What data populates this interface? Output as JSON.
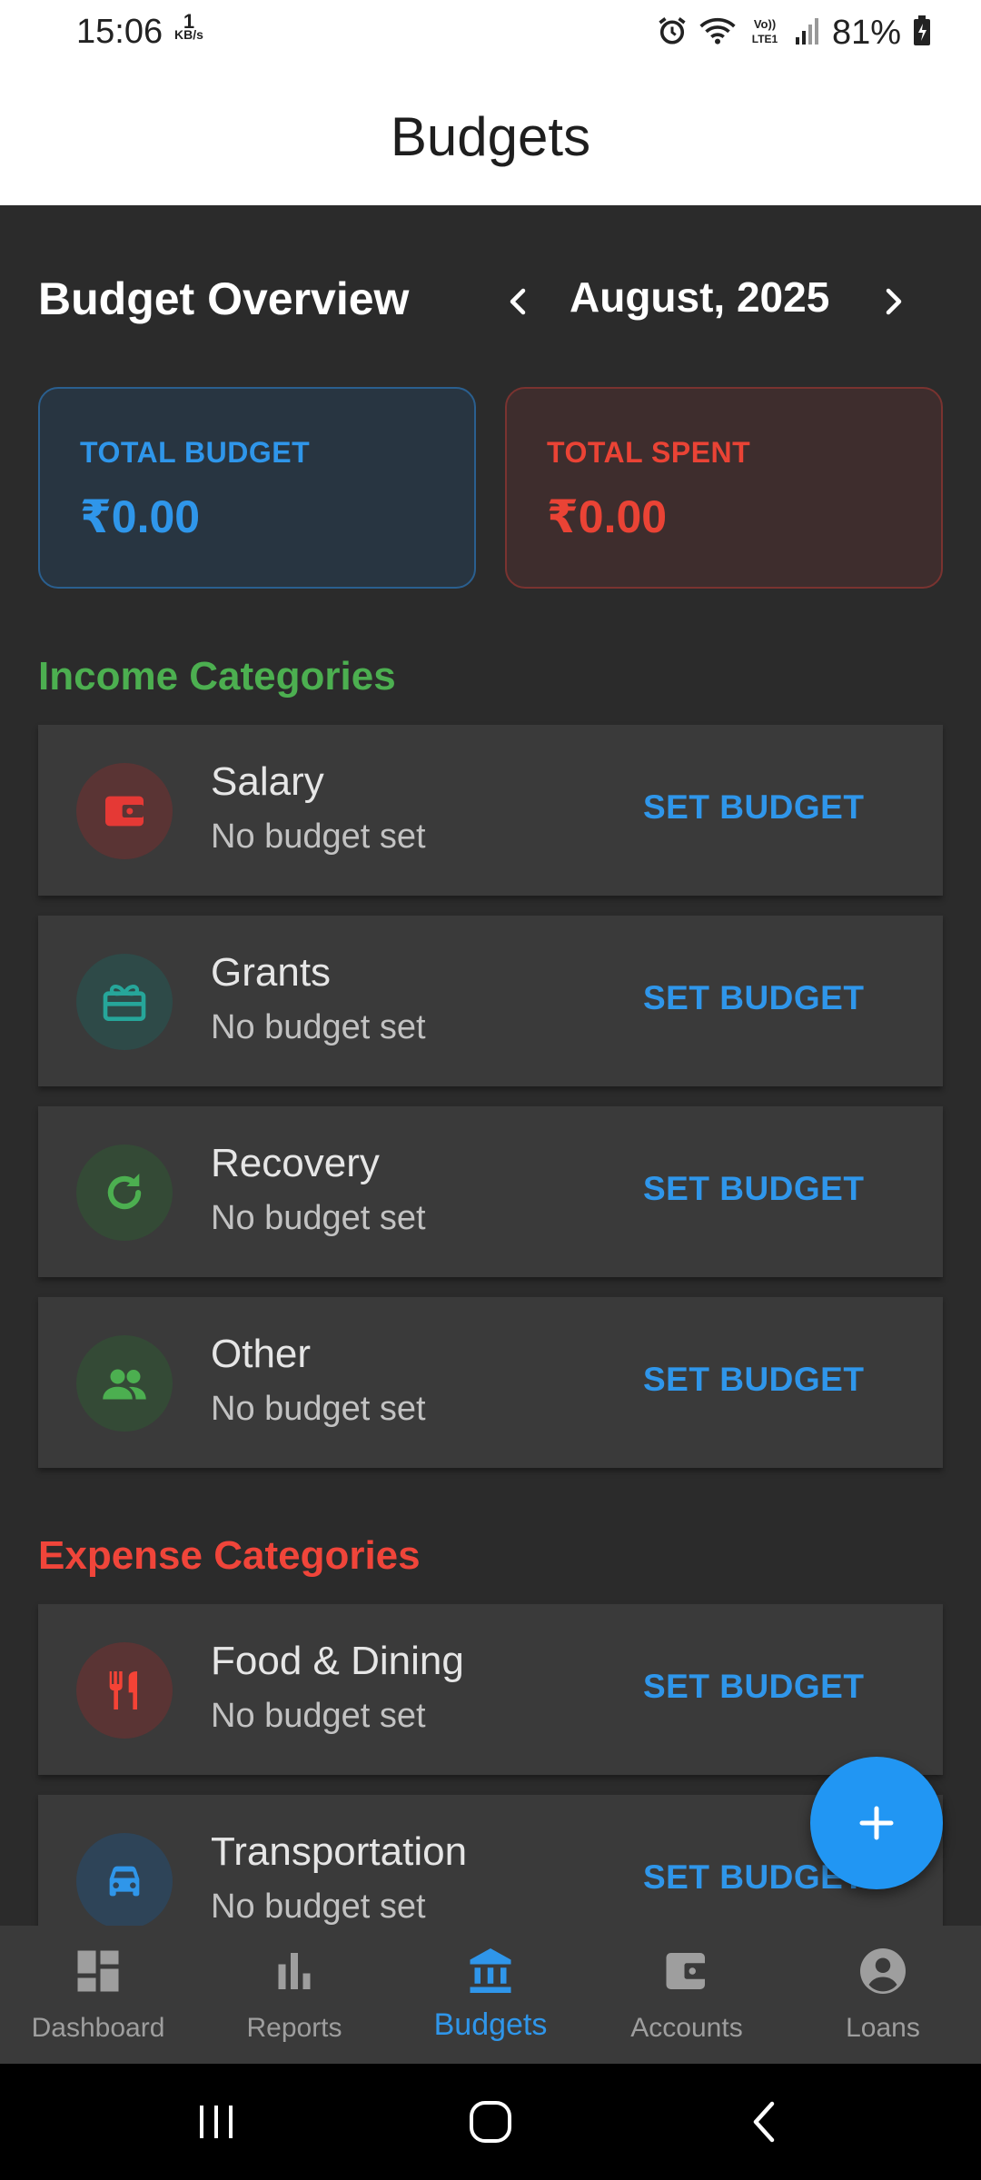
{
  "status_bar": {
    "time": "15:06",
    "speed_value": "1",
    "speed_unit": "KB/s",
    "battery": "81%"
  },
  "app_bar": {
    "title": "Budgets"
  },
  "overview": {
    "title": "Budget Overview",
    "month": "August, 2025"
  },
  "summary": {
    "total_budget_label": "TOTAL BUDGET",
    "total_budget_value": "₹0.00",
    "total_spent_label": "TOTAL SPENT",
    "total_spent_value": "₹0.00"
  },
  "income": {
    "title": "Income Categories",
    "items": [
      {
        "name": "Salary",
        "status": "No budget set",
        "action": "SET BUDGET",
        "icon": "wallet-icon",
        "icon_color": "#e53935",
        "icon_bg": "#5a3434"
      },
      {
        "name": "Grants",
        "status": "No budget set",
        "action": "SET BUDGET",
        "icon": "gift-card-icon",
        "icon_color": "#26a69a",
        "icon_bg": "#2e4a48"
      },
      {
        "name": "Recovery",
        "status": "No budget set",
        "action": "SET BUDGET",
        "icon": "refresh-icon",
        "icon_color": "#4caf50",
        "icon_bg": "#344a36"
      },
      {
        "name": "Other",
        "status": "No budget set",
        "action": "SET BUDGET",
        "icon": "people-icon",
        "icon_color": "#4caf50",
        "icon_bg": "#344a36"
      }
    ]
  },
  "expense": {
    "title": "Expense Categories",
    "items": [
      {
        "name": "Food & Dining",
        "status": "No budget set",
        "action": "SET BUDGET",
        "icon": "utensils-icon",
        "icon_color": "#f44336",
        "icon_bg": "#5a3434"
      },
      {
        "name": "Transportation",
        "status": "No budget set",
        "action": "SET BUDGET",
        "icon": "car-icon",
        "icon_color": "#2f96ea",
        "icon_bg": "#2e4458"
      }
    ]
  },
  "bottom_nav": {
    "items": [
      {
        "label": "Dashboard",
        "icon": "dashboard-icon"
      },
      {
        "label": "Reports",
        "icon": "bar-chart-icon"
      },
      {
        "label": "Budgets",
        "icon": "bank-icon",
        "active": true
      },
      {
        "label": "Accounts",
        "icon": "wallet-icon"
      },
      {
        "label": "Loans",
        "icon": "account-circle-icon"
      }
    ]
  },
  "colors": {
    "accent": "#2f96ea",
    "income": "#4caf50",
    "expense": "#f0453a",
    "background": "#2b2b2b",
    "card": "#3a3a3a"
  }
}
